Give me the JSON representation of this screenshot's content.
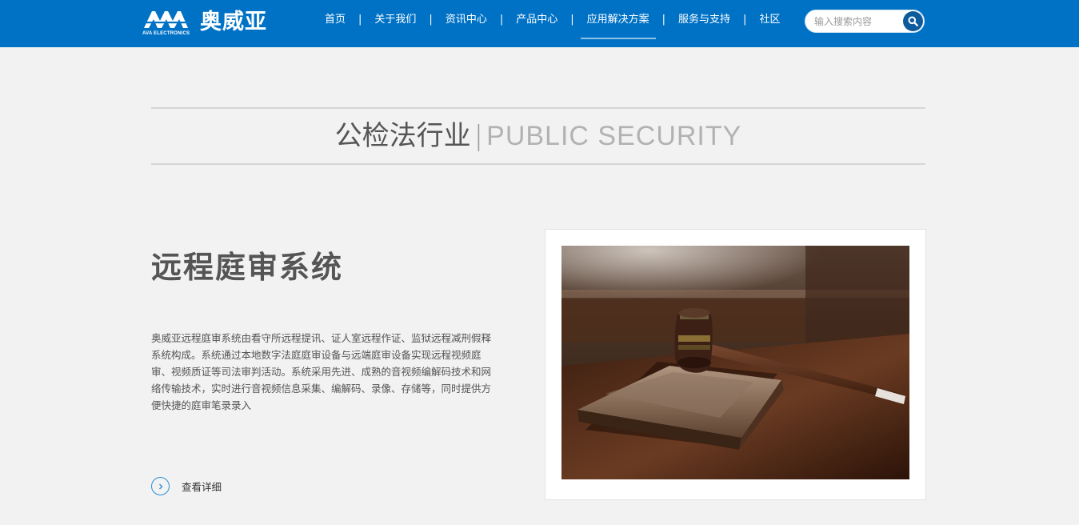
{
  "header": {
    "logo_mark_text": "AVA",
    "logo_sub_text": "AVA ELECTRONICS",
    "logo_cn_text": "奥威亚",
    "nav": [
      {
        "label": "首页"
      },
      {
        "label": "关于我们"
      },
      {
        "label": "资讯中心"
      },
      {
        "label": "产品中心"
      },
      {
        "label": "应用解决方案",
        "active": true
      },
      {
        "label": "服务与支持"
      },
      {
        "label": "社区"
      }
    ],
    "nav_separator": "|",
    "search": {
      "placeholder": "输入搜索内容",
      "icon": "search-icon"
    }
  },
  "section": {
    "title_cn": "公检法行业",
    "separator": "|",
    "title_en": "PUBLIC SECURITY"
  },
  "content": {
    "title": "远程庭审系统",
    "description": "奥威亚远程庭审系统由看守所远程提讯、证人室远程作证、监狱远程减刑假释系统构成。系统通过本地数字法庭庭审设备与远端庭审设备实现远程视频庭审、视频质证等司法审判活动。系统采用先进、成熟的音视频编解码技术和网络传输技术，实时进行音视频信息采集、编解码、录像、存储等，同时提供方便快捷的庭审笔录录入",
    "more_label": "查看详细",
    "more_icon": "chevron-right-icon",
    "image_subject": "gavel-icon"
  },
  "colors": {
    "header_bg": "#0072c6",
    "page_bg": "#f2f2f2",
    "accent": "#2b8fd6"
  }
}
